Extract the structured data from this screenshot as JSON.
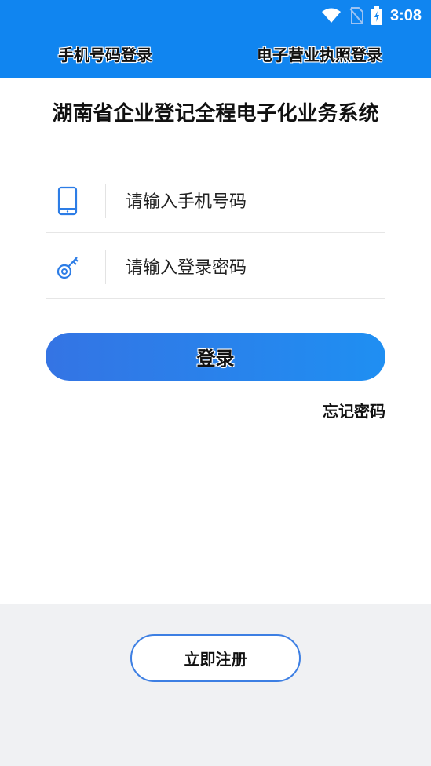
{
  "status_bar": {
    "time": "3:08",
    "icons": [
      "wifi-icon",
      "no-sim-icon",
      "battery-charging-icon"
    ]
  },
  "tabs": [
    {
      "label": "手机号码登录"
    },
    {
      "label": "电子营业执照登录"
    }
  ],
  "app_title": "湖南省企业登记全程电子化业务系统",
  "form": {
    "phone": {
      "placeholder": "请输入手机号码",
      "icon": "phone-icon"
    },
    "password": {
      "placeholder": "请输入登录密码",
      "icon": "key-icon"
    },
    "login_label": "登录",
    "forgot_label": "忘记密码"
  },
  "footer": {
    "register_label": "立即注册"
  },
  "colors": {
    "header": "#1085f0",
    "accent": "#3d7fe3",
    "footer_bg": "#f0f1f3"
  }
}
